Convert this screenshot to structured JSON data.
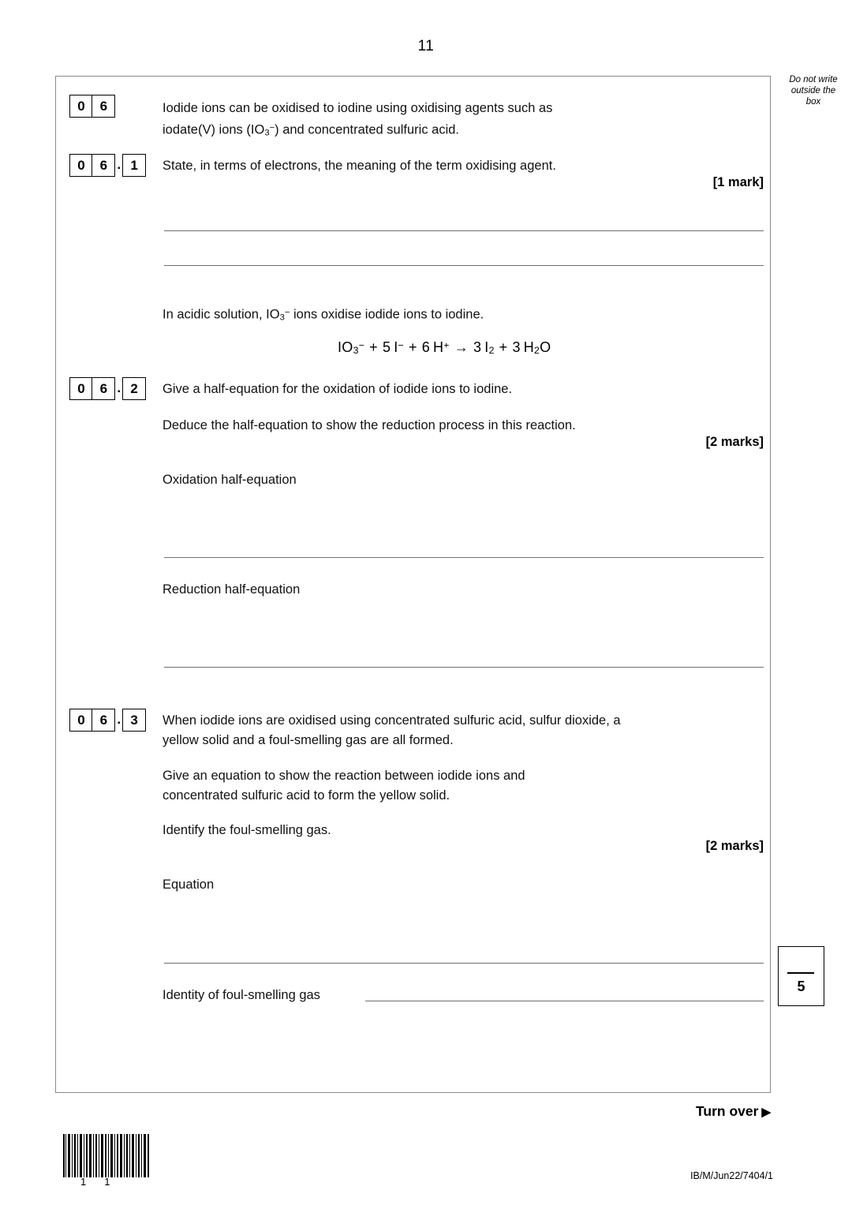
{
  "page": {
    "number": "11",
    "margin_note": [
      "Do not write",
      "outside the",
      "box"
    ],
    "turn_over": "Turn over",
    "turn_over_arrow": "▶",
    "doc_code": "IB/M/Jun22/7404/1",
    "barcode_digits_left": "1",
    "barcode_digits_right": "1"
  },
  "question": {
    "number_digits": [
      "0",
      "6"
    ],
    "stem": "Iodide ions can be oxidised to iodine using oxidising agents such as iodate(V) ions (IO3−) and concentrated sulfuric acid.",
    "stem_line1": "Iodide ions can be oxidised to iodine using oxidising agents such as",
    "stem_line2_a": "iodate(V) ions (IO",
    "stem_line2_sub": "3",
    "stem_line2_sup": "−",
    "stem_line2_b": ") and concentrated sulfuric acid."
  },
  "parts": [
    {
      "id": "06.1",
      "digits": [
        "0",
        "6"
      ],
      "sub": "1",
      "prompt": "State, in terms of electrons, the meaning of the term oxidising agent.",
      "marks": "[1 mark]",
      "answer_lines": 2
    },
    {
      "id": "06.2",
      "digits": [
        "0",
        "6"
      ],
      "sub": "2",
      "prompt": "Give a half-equation for the oxidation of iodide ions to iodine.",
      "prompt2": "Deduce the half-equation to show the reduction process in this reaction.",
      "marks": "[2 marks]",
      "label_oxidation": "Oxidation half-equation",
      "label_reduction": "Reduction half-equation"
    },
    {
      "id": "06.3",
      "digits": [
        "0",
        "6"
      ],
      "sub": "3",
      "prompt_line1": "When iodide ions are oxidised using concentrated sulfuric acid, sulfur dioxide, a",
      "prompt_line2": "yellow solid and a foul-smelling gas are all formed.",
      "prompt2_line1": "Give an equation to show the reaction between iodide ions and",
      "prompt2_line2": "concentrated sulfuric acid to form the yellow solid.",
      "prompt3": "Identify the foul-smelling gas.",
      "marks": "[2 marks]",
      "label_equation": "Equation",
      "label_identity": "Identity of foul-smelling gas"
    }
  ],
  "intro_text": {
    "lead_a": "In acidic solution, IO",
    "lead_sub": "3",
    "lead_sup": "−",
    "lead_b": " ions oxidise iodide ions to iodine."
  },
  "chemical_equation": {
    "terms": [
      {
        "base": "IO",
        "sub": "3",
        "sup": "−"
      },
      {
        "op": "+"
      },
      {
        "coef": "5",
        "base": "I",
        "sup": "−"
      },
      {
        "op": "+"
      },
      {
        "coef": "6",
        "base": "H",
        "sup": "+"
      },
      {
        "op": "→"
      },
      {
        "coef": "3",
        "base": "I",
        "sub": "2"
      },
      {
        "op": "+"
      },
      {
        "coef": "3",
        "base": "H",
        "sub": "2",
        "base2": "O"
      }
    ],
    "plain": "IO3− + 5I− + 6H+ → 3I2 + 3H2O"
  },
  "mark_total": {
    "value": "5"
  }
}
